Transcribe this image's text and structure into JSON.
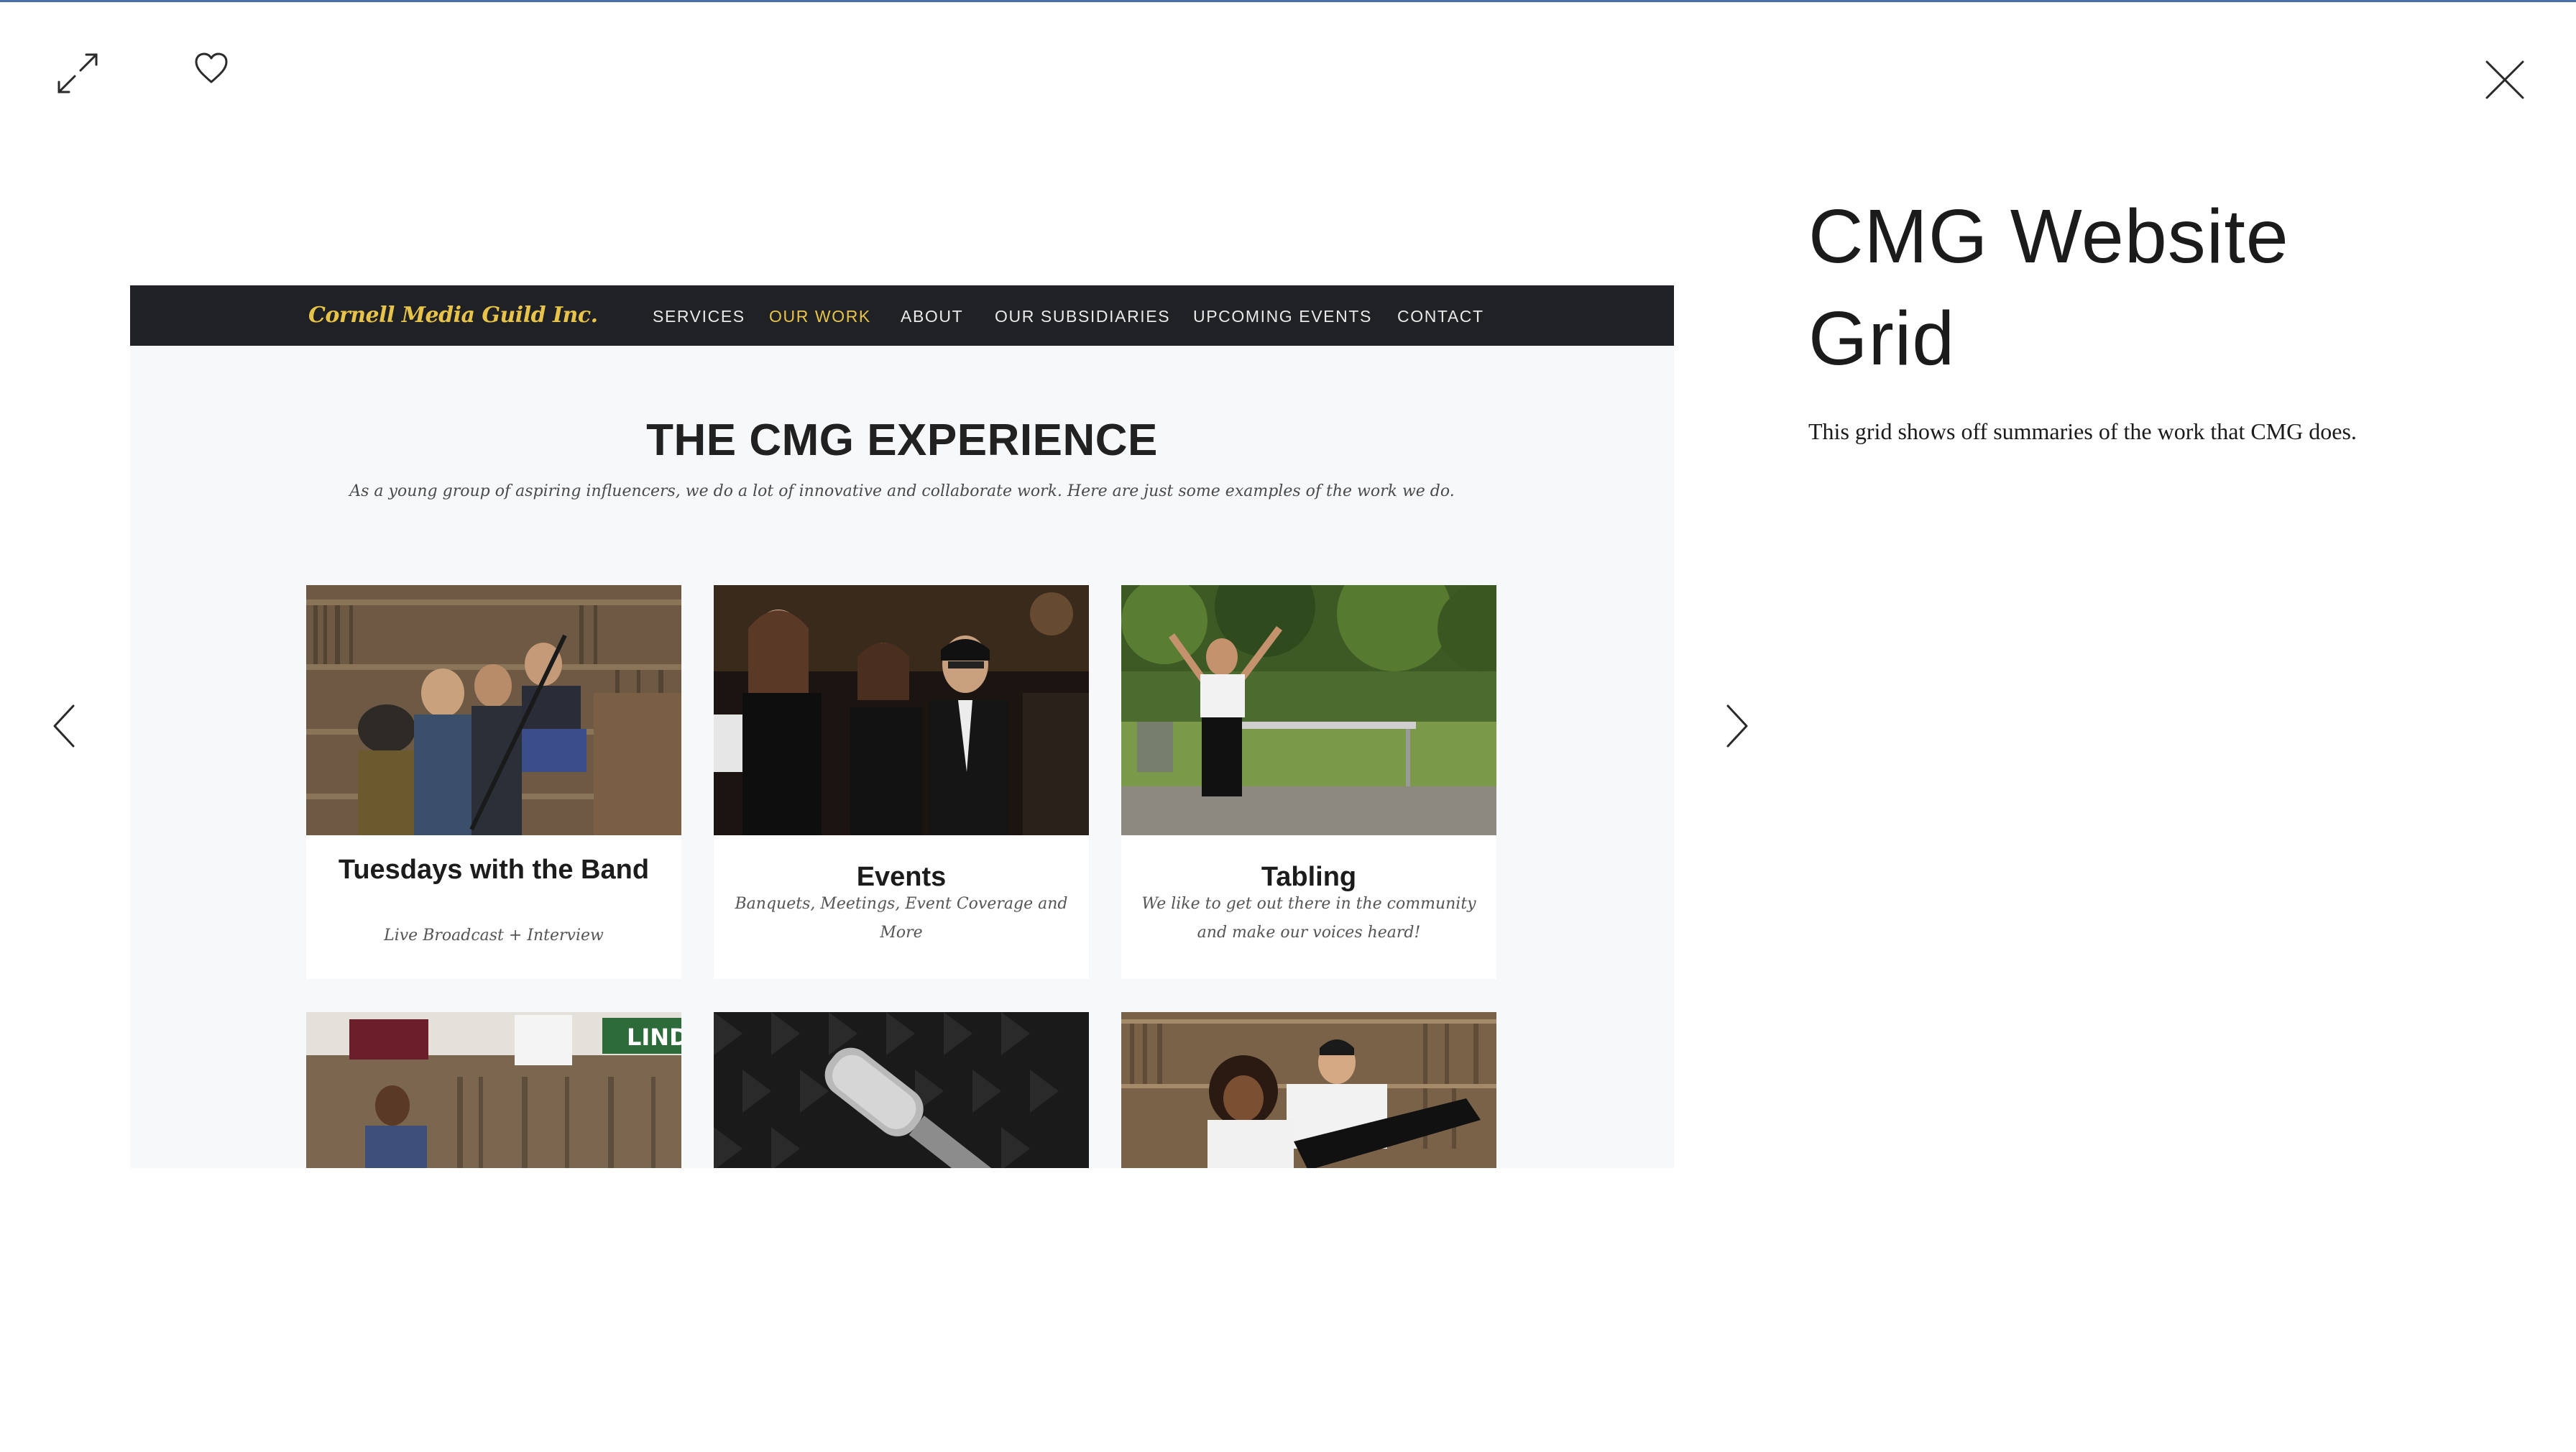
{
  "lightbox": {
    "expand_icon": "expand-arrows-icon",
    "heart_icon": "heart-outline-icon",
    "close_icon": "close-x-icon",
    "prev_icon": "chevron-left-icon",
    "next_icon": "chevron-right-icon"
  },
  "site": {
    "logo": "Cornell Media Guild Inc.",
    "nav": [
      {
        "label": "SERVICES",
        "active": false
      },
      {
        "label": "OUR WORK",
        "active": true
      },
      {
        "label": "ABOUT",
        "active": false
      },
      {
        "label": "OUR SUBSIDIARIES",
        "active": false
      },
      {
        "label": "UPCOMING EVENTS",
        "active": false
      },
      {
        "label": "CONTACT",
        "active": false
      }
    ],
    "heading": "THE CMG EXPERIENCE",
    "intro": "As a young group of aspiring influencers, we do a lot of innovative and collaborate work. Here are just some examples of the work we do.",
    "cards": [
      {
        "title": "Tuesdays with the Band",
        "subtitle": "Live Broadcast + Interview",
        "photo": "band-in-record-library-photo"
      },
      {
        "title": "Events",
        "subtitle": "Banquets, Meetings, Event Coverage and More",
        "photo": "students-at-event-photo"
      },
      {
        "title": "Tabling",
        "subtitle": "We like to get out there in the community and make our voices heard!",
        "photo": "tabling-outdoors-photo"
      },
      {
        "title": "",
        "subtitle": "",
        "photo": "dj-in-studio-photo"
      },
      {
        "title": "",
        "subtitle": "",
        "photo": "microphone-photo"
      },
      {
        "title": "",
        "subtitle": "",
        "photo": "duo-in-record-library-photo"
      }
    ]
  },
  "detail": {
    "title": "CMG Website Grid",
    "description": "This grid shows off summaries of the work that CMG does."
  },
  "colors": {
    "accent": "#e8c34a",
    "nav_bg": "#1f2124",
    "page_bg": "#f7f8fa"
  }
}
